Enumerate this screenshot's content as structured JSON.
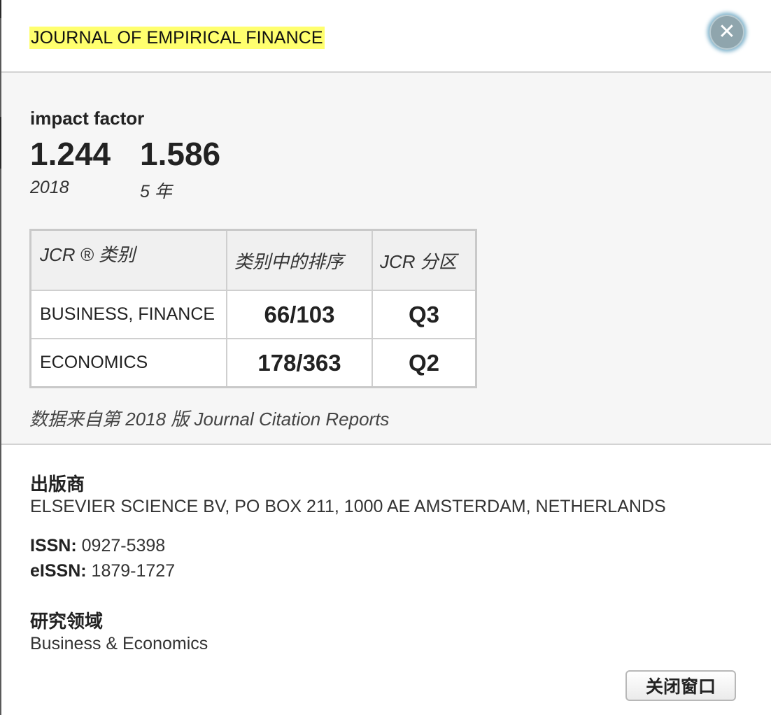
{
  "journal": {
    "title": "JOURNAL OF EMPIRICAL FINANCE"
  },
  "close_icon": "close-icon",
  "impact_factor": {
    "label": "impact factor",
    "values": [
      {
        "value": "1.244",
        "sub": "2018"
      },
      {
        "value": "1.586",
        "sub": "5 年"
      }
    ]
  },
  "jcr_table": {
    "headers": {
      "category": "JCR ® 类别",
      "rank": "类别中的排序",
      "quartile": "JCR 分区"
    },
    "rows": [
      {
        "category": "BUSINESS, FINANCE",
        "rank": "66/103",
        "quartile": "Q3"
      },
      {
        "category": "ECONOMICS",
        "rank": "178/363",
        "quartile": "Q2"
      }
    ],
    "source_note": "数据来自第 2018 版 Journal Citation Reports"
  },
  "publisher": {
    "heading": "出版商",
    "text": "ELSEVIER SCIENCE BV, PO BOX 211, 1000 AE AMSTERDAM, NETHERLANDS"
  },
  "issn": {
    "label": "ISSN:",
    "value": "0927-5398"
  },
  "eissn": {
    "label": "eISSN:",
    "value": "1879-1727"
  },
  "research_area": {
    "heading": "研究领域",
    "text": "Business & Economics"
  },
  "footer": {
    "close_window_label": "关闭窗口"
  },
  "colors": {
    "title_highlight": "#ffff6e",
    "section_bg": "#f6f6f6",
    "close_button": "#8fa5ad"
  }
}
